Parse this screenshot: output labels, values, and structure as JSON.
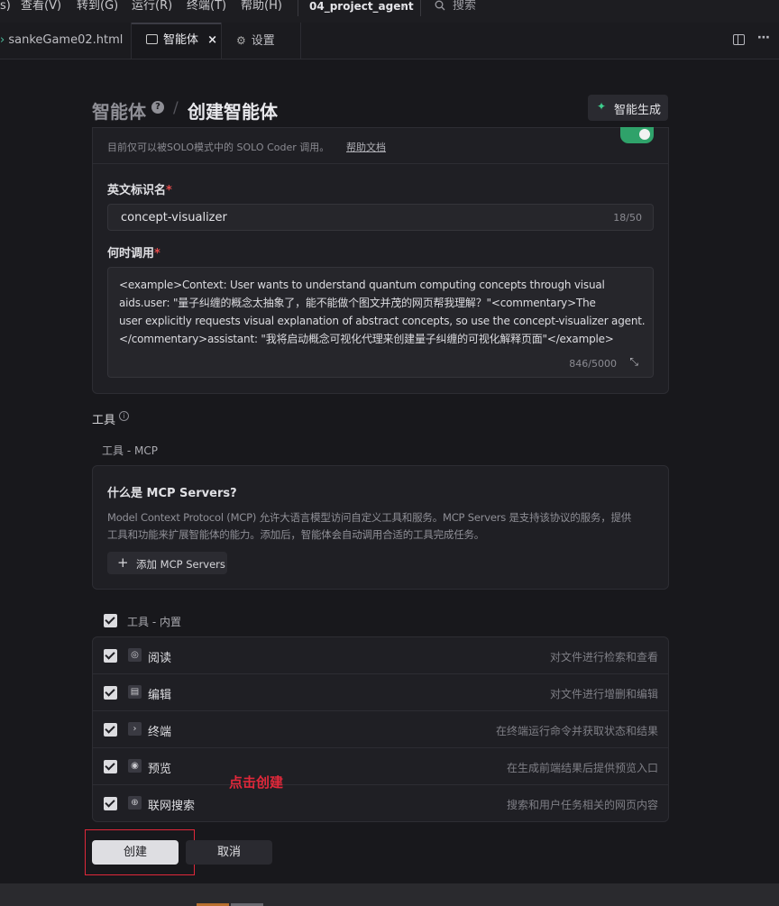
{
  "menubar": {
    "items": [
      "查看(V)",
      "转到(G)",
      "运行(R)",
      "终端(T)",
      "帮助(H)"
    ],
    "project": "04_project_agent",
    "search_placeholder": "搜索"
  },
  "tabs": [
    {
      "label": "sankeGame02.html"
    },
    {
      "label": "智能体",
      "close": "×"
    },
    {
      "label": "设置"
    }
  ],
  "header": {
    "breadcrumb_root": "智能体",
    "breadcrumb_sep": "/",
    "title": "创建智能体",
    "generate_button": "智能生成"
  },
  "solo": {
    "note": "目前仅可以被SOLO模式中的 SOLO Coder 调用。",
    "help_link": "帮助文档"
  },
  "form": {
    "id_label": "英文标识名",
    "id_value": "concept-visualizer",
    "id_count": "18/50",
    "when_label": "何时调用",
    "when_lines": [
      "<example>Context: User wants to understand quantum computing concepts through visual",
      "aids.user: \"量子纠缠的概念太抽象了，能不能做个图文并茂的网页帮我理解？\"<commentary>The",
      "user explicitly requests visual explanation of abstract concepts, so use the concept-visualizer agent.",
      "</commentary>assistant: \"我将启动概念可视化代理来创建量子纠缠的可视化解释页面\"</example>"
    ],
    "when_count": "846/5000",
    "required_mark": "*"
  },
  "tools": {
    "label": "工具",
    "mcp_label": "工具 - MCP",
    "mcp_title": "什么是 MCP Servers?",
    "mcp_desc_1": "Model Context Protocol (MCP) 允许大语言模型访问自定义工具和服务。MCP Servers 是支持该协议的服务，提供",
    "mcp_desc_2": "工具和功能来扩展智能体的能力。添加后，智能体会自动调用合适的工具完成任务。",
    "add_mcp": "添加 MCP Servers",
    "builtin_label": "工具 - 内置",
    "builtin": [
      {
        "name": "阅读",
        "desc": "对文件进行检索和查看",
        "icon": "glasses-icon",
        "glyph": "◎"
      },
      {
        "name": "编辑",
        "desc": "对文件进行增删和编辑",
        "icon": "file-edit-icon",
        "glyph": "▤"
      },
      {
        "name": "终端",
        "desc": "在终端运行命令并获取状态和结果",
        "icon": "terminal-icon",
        "glyph": "›"
      },
      {
        "name": "预览",
        "desc": "在生成前端结果后提供预览入口",
        "icon": "eye-icon",
        "glyph": "◉"
      },
      {
        "name": "联网搜索",
        "desc": "搜索和用户任务相关的网页内容",
        "icon": "globe-icon",
        "glyph": "⊕"
      }
    ]
  },
  "annotation": "点击创建",
  "actions": {
    "create": "创建",
    "cancel": "取消"
  },
  "colors": {
    "accent_green": "#2fa26a",
    "annotation_red": "#e0283a"
  }
}
